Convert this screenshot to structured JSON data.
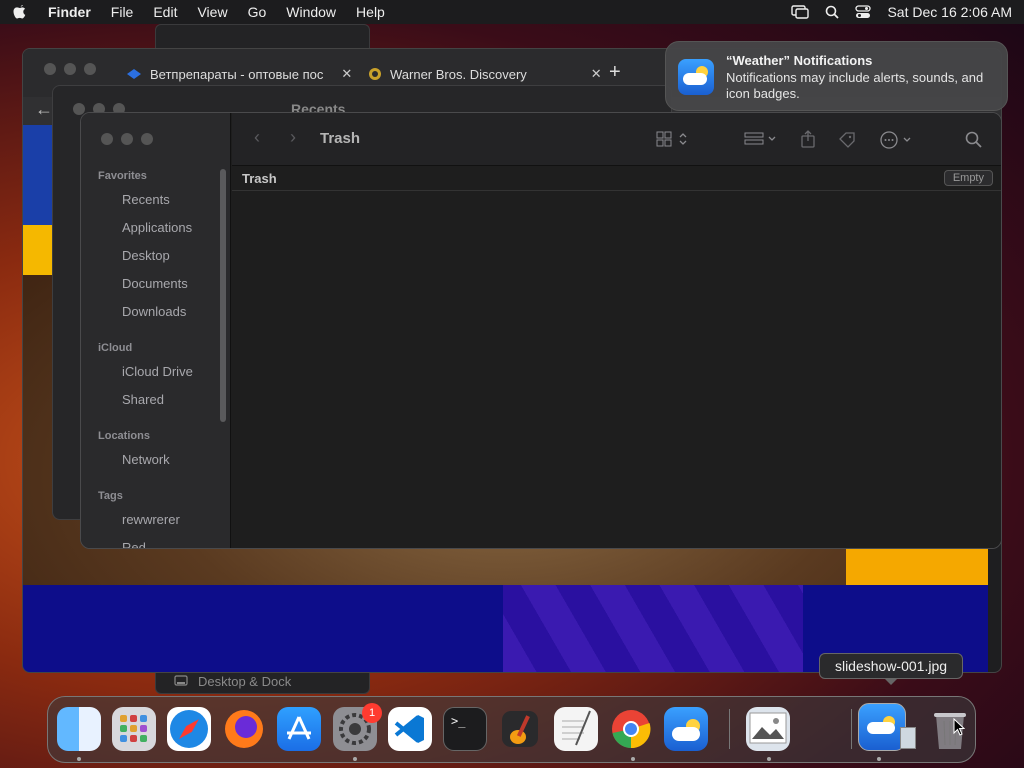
{
  "menubar": {
    "app": "Finder",
    "menus": [
      "File",
      "Edit",
      "View",
      "Go",
      "Window",
      "Help"
    ],
    "datetime": "Sat Dec 16  2:06 AM"
  },
  "browser": {
    "tabs": [
      {
        "title": "Ветпрепараты - оптовые пос"
      },
      {
        "title": "Warner Bros. Discovery"
      }
    ]
  },
  "finder_back": {
    "title": "Recents"
  },
  "finder": {
    "title": "Trash",
    "path_label": "Trash",
    "empty_button": "Empty",
    "sidebar": {
      "favorites_header": "Favorites",
      "favorites": [
        "Recents",
        "Applications",
        "Desktop",
        "Documents",
        "Downloads"
      ],
      "icloud_header": "iCloud",
      "icloud": [
        "iCloud Drive",
        "Shared"
      ],
      "locations_header": "Locations",
      "locations": [
        "Network"
      ],
      "tags_header": "Tags",
      "tags": [
        "rewwrerer",
        "Red"
      ]
    }
  },
  "notification": {
    "title": "“Weather” Notifications",
    "body": "Notifications may include alerts, sounds, and icon badges."
  },
  "settings_window": {
    "item": "Desktop & Dock"
  },
  "tooltip": "slideshow-001.jpg",
  "dock": {
    "settings_badge": "1"
  }
}
